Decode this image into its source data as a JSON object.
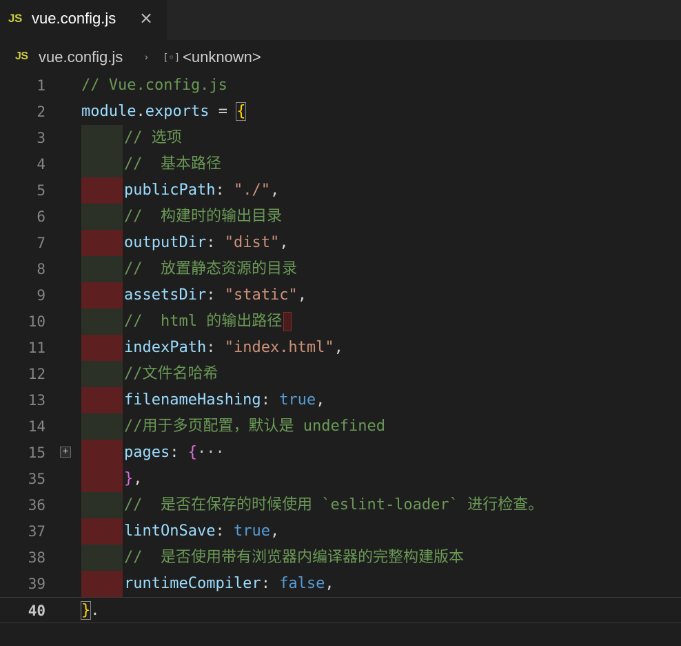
{
  "tab": {
    "badge": "JS",
    "title": "vue.config.js",
    "close": "×"
  },
  "breadcrumb": {
    "badge": "JS",
    "file": "vue.config.js",
    "separator": "›",
    "symbol_icon": "[◦]",
    "symbol": "<unknown>"
  },
  "editor": {
    "fold_label": "+",
    "lines": [
      {
        "n": "1",
        "indent": "",
        "tokens": [
          {
            "t": "// Vue.config.js",
            "c": "c-comment"
          }
        ]
      },
      {
        "n": "2",
        "indent": "",
        "tokens": [
          {
            "t": "module",
            "c": "c-var"
          },
          {
            "t": ".",
            "c": "c-plain"
          },
          {
            "t": "exports",
            "c": "c-var"
          },
          {
            "t": " = ",
            "c": "c-plain"
          },
          {
            "t": "{",
            "c": "c-brace-y"
          }
        ]
      },
      {
        "n": "3",
        "indent": "green",
        "tokens": [
          {
            "t": "// 选项",
            "c": "c-comment"
          }
        ]
      },
      {
        "n": "4",
        "indent": "green",
        "tokens": [
          {
            "t": "//  基本路径",
            "c": "c-comment"
          }
        ]
      },
      {
        "n": "5",
        "indent": "red",
        "tokens": [
          {
            "t": "publicPath",
            "c": "c-var"
          },
          {
            "t": ": ",
            "c": "c-plain"
          },
          {
            "t": "\"./\"",
            "c": "c-str"
          },
          {
            "t": ",",
            "c": "c-plain"
          }
        ]
      },
      {
        "n": "6",
        "indent": "green",
        "tokens": [
          {
            "t": "//  构建时的输出目录",
            "c": "c-comment"
          }
        ]
      },
      {
        "n": "7",
        "indent": "red",
        "tokens": [
          {
            "t": "outputDir",
            "c": "c-var"
          },
          {
            "t": ": ",
            "c": "c-plain"
          },
          {
            "t": "\"dist\"",
            "c": "c-str"
          },
          {
            "t": ",",
            "c": "c-plain"
          }
        ]
      },
      {
        "n": "8",
        "indent": "green",
        "tokens": [
          {
            "t": "//  放置静态资源的目录",
            "c": "c-comment"
          }
        ]
      },
      {
        "n": "9",
        "indent": "red",
        "tokens": [
          {
            "t": "assetsDir",
            "c": "c-var"
          },
          {
            "t": ": ",
            "c": "c-plain"
          },
          {
            "t": "\"static\"",
            "c": "c-str"
          },
          {
            "t": ",",
            "c": "c-plain"
          }
        ]
      },
      {
        "n": "10",
        "indent": "green",
        "cursor": true,
        "tokens": [
          {
            "t": "//  html 的输出路径",
            "c": "c-comment"
          }
        ]
      },
      {
        "n": "11",
        "indent": "red",
        "tokens": [
          {
            "t": "indexPath",
            "c": "c-var"
          },
          {
            "t": ": ",
            "c": "c-plain"
          },
          {
            "t": "\"index.html\"",
            "c": "c-str"
          },
          {
            "t": ",",
            "c": "c-plain"
          }
        ]
      },
      {
        "n": "12",
        "indent": "green",
        "tokens": [
          {
            "t": "//文件名哈希",
            "c": "c-comment"
          }
        ]
      },
      {
        "n": "13",
        "indent": "red",
        "tokens": [
          {
            "t": "filenameHashing",
            "c": "c-var"
          },
          {
            "t": ": ",
            "c": "c-plain"
          },
          {
            "t": "true",
            "c": "c-bool"
          },
          {
            "t": ",",
            "c": "c-plain"
          }
        ]
      },
      {
        "n": "14",
        "indent": "green",
        "tokens": [
          {
            "t": "//用于多页配置，默认是 undefined",
            "c": "c-comment"
          }
        ]
      },
      {
        "n": "15",
        "indent": "red",
        "fold": true,
        "tokens": [
          {
            "t": "pages",
            "c": "c-var"
          },
          {
            "t": ": ",
            "c": "c-plain"
          },
          {
            "t": "{",
            "c": "c-brace-p"
          },
          {
            "t": "···",
            "c": "c-fold"
          }
        ]
      },
      {
        "n": "35",
        "indent": "red",
        "tokens": [
          {
            "t": "}",
            "c": "c-brace-p"
          },
          {
            "t": ",",
            "c": "c-plain"
          }
        ]
      },
      {
        "n": "36",
        "indent": "green",
        "tokens": [
          {
            "t": "//  是否在保存的时候使用 `eslint-loader` 进行检查。",
            "c": "c-comment"
          }
        ]
      },
      {
        "n": "37",
        "indent": "red",
        "tokens": [
          {
            "t": "lintOnSave",
            "c": "c-var"
          },
          {
            "t": ": ",
            "c": "c-plain"
          },
          {
            "t": "true",
            "c": "c-bool"
          },
          {
            "t": ",",
            "c": "c-plain"
          }
        ]
      },
      {
        "n": "38",
        "indent": "green",
        "tokens": [
          {
            "t": "//  是否使用带有浏览器内编译器的完整构建版本",
            "c": "c-comment"
          }
        ]
      },
      {
        "n": "39",
        "indent": "red",
        "tokens": [
          {
            "t": "runtimeCompiler",
            "c": "c-var"
          },
          {
            "t": ": ",
            "c": "c-plain"
          },
          {
            "t": "false",
            "c": "c-bool"
          },
          {
            "t": ",",
            "c": "c-plain"
          }
        ]
      },
      {
        "n": "40",
        "indent": "",
        "active": true,
        "tokens": [
          {
            "t": "}",
            "c": "c-brace-y"
          },
          {
            "t": ".",
            "c": "c-plain"
          }
        ]
      }
    ]
  },
  "colors": {
    "background": "#1e1e1e",
    "comment": "#6a9955",
    "property": "#9cdcfe",
    "string": "#ce9178",
    "keyword": "#569cd6",
    "js_badge": "#cbcb41"
  }
}
